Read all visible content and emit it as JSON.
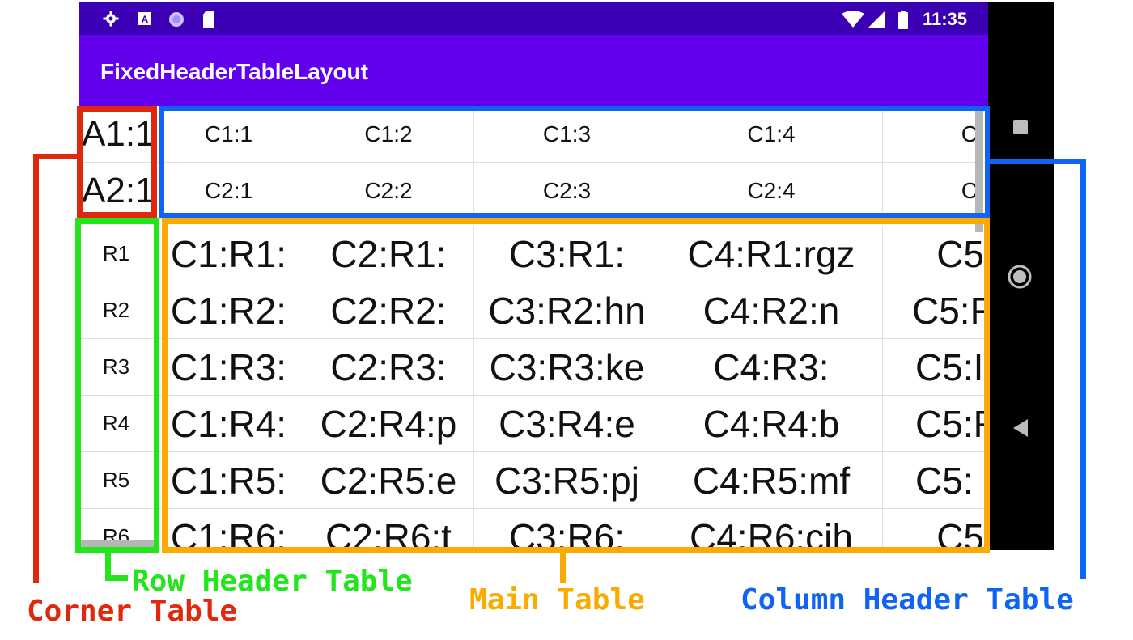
{
  "status_bar": {
    "time": "11:35",
    "left_icons": [
      "gear-icon",
      "a-square-icon",
      "circle-icon",
      "sd-card-icon"
    ],
    "right_icons": [
      "wifi-icon",
      "signal-icon",
      "battery-icon"
    ]
  },
  "app_bar": {
    "title": "FixedHeaderTableLayout"
  },
  "corner_table": {
    "cells": [
      "A1:1",
      "A2:1"
    ]
  },
  "column_header_table": {
    "rows": [
      [
        "C1:1",
        "C1:2",
        "C1:3",
        "C1:4",
        "C"
      ],
      [
        "C2:1",
        "C2:2",
        "C2:3",
        "C2:4",
        "C"
      ]
    ]
  },
  "row_header_table": {
    "cells": [
      "R1",
      "R2",
      "R3",
      "R4",
      "R5",
      "R6"
    ]
  },
  "main_table": {
    "rows": [
      [
        "C1:R1:",
        "C2:R1:",
        "C3:R1:",
        "C4:R1:rgz",
        "C5"
      ],
      [
        "C1:R2:",
        "C2:R2:",
        "C3:R2:hn",
        "C4:R2:n",
        "C5:F"
      ],
      [
        "C1:R3:",
        "C2:R3:",
        "C3:R3:ke",
        "C4:R3:",
        "C5:I"
      ],
      [
        "C1:R4:",
        "C2:R4:p",
        "C3:R4:e",
        "C4:R4:b",
        "C5:F"
      ],
      [
        "C1:R5:",
        "C2:R5:e",
        "C3:R5:pj",
        "C4:R5:mf",
        "C5:"
      ],
      [
        "C1:R6:",
        "C2:R6:t",
        "C3:R6:",
        "C4:R6:cih",
        "C5"
      ]
    ]
  },
  "nav_bar": {
    "icons": [
      "recents-square-icon",
      "home-circle-icon",
      "back-triangle-icon"
    ]
  },
  "annotations": {
    "corner": {
      "label": "Corner Table",
      "color": "#e0280e"
    },
    "row_header": {
      "label": "Row Header Table",
      "color": "#22e51c"
    },
    "main": {
      "label": "Main Table",
      "color": "#fbaa00"
    },
    "column_header": {
      "label": "Column Header Table",
      "color": "#0f63f5"
    }
  }
}
